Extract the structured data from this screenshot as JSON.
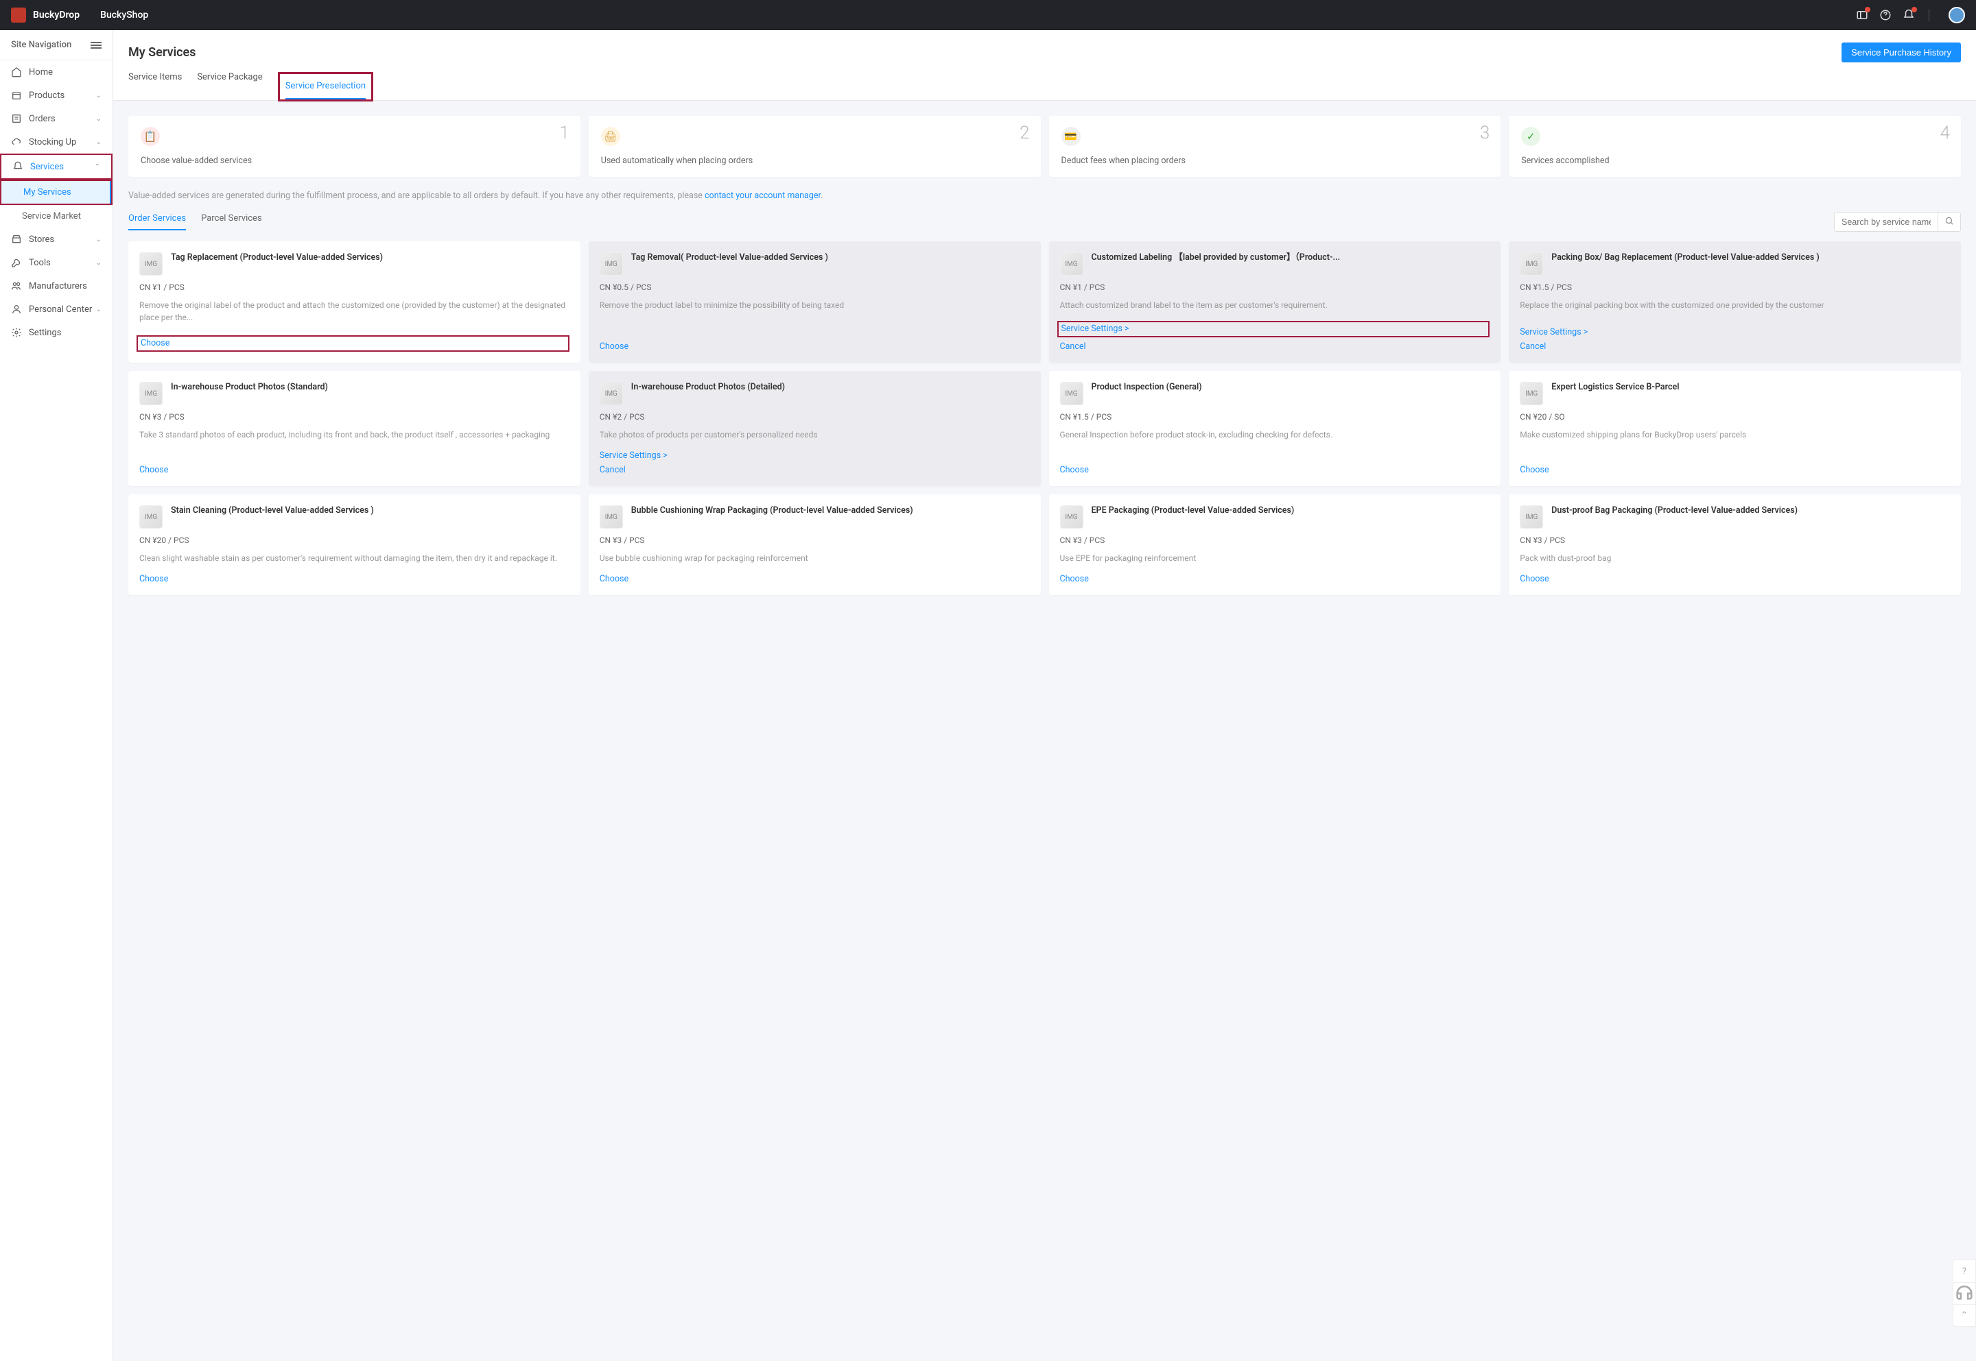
{
  "header": {
    "brand1": "BuckyDrop",
    "brand2": "BuckyShop"
  },
  "sidebar": {
    "navLabel": "Site Navigation",
    "items": [
      {
        "label": "Home",
        "icon": "home"
      },
      {
        "label": "Products",
        "icon": "box",
        "chev": true
      },
      {
        "label": "Orders",
        "icon": "list",
        "chev": true
      },
      {
        "label": "Stocking Up",
        "icon": "cloud",
        "chev": true
      },
      {
        "label": "Services",
        "icon": "bell",
        "chev": true,
        "open": true,
        "hl": true,
        "subs": [
          {
            "label": "My Services",
            "active": true,
            "hl": true
          },
          {
            "label": "Service Market"
          }
        ]
      },
      {
        "label": "Stores",
        "icon": "store",
        "chev": true
      },
      {
        "label": "Tools",
        "icon": "wrench",
        "chev": true
      },
      {
        "label": "Manufacturers",
        "icon": "people"
      },
      {
        "label": "Personal Center",
        "icon": "person",
        "chev": true
      },
      {
        "label": "Settings",
        "icon": "gear"
      }
    ]
  },
  "page": {
    "title": "My Services",
    "historyBtn": "Service Purchase History",
    "tabs": [
      "Service Items",
      "Service Package",
      "Service Preselection"
    ],
    "activeTab": 2
  },
  "steps": [
    {
      "n": "1",
      "label": "Choose value-added services"
    },
    {
      "n": "2",
      "label": "Used automatically when placing orders"
    },
    {
      "n": "3",
      "label": "Deduct fees when placing orders"
    },
    {
      "n": "4",
      "label": "Services accomplished"
    }
  ],
  "notice": {
    "text": "Value-added services are generated during the fulfillment process, and are applicable to all orders by default. If you have any other requirements, please ",
    "link": "contact your account manager"
  },
  "serviceTabs": [
    "Order Services",
    "Parcel Services"
  ],
  "search": {
    "placeholder": "Search by service name"
  },
  "actions": {
    "choose": "Choose",
    "settings": "Service Settings  >",
    "cancel": "Cancel"
  },
  "cards": [
    {
      "title": "Tag Replacement (Product-level Value-added Services)",
      "price": "CN ¥1 / PCS",
      "desc": "Remove the original label of the product and attach the customized one (provided by the customer) at the designated place per the...",
      "act": "choose",
      "hlAction": true
    },
    {
      "title": "Tag Removal( Product-level Value-added Services )",
      "price": "CN ¥0.5 / PCS",
      "desc": "Remove the product label to minimize the possibility of being taxed",
      "act": "choose",
      "sel": true
    },
    {
      "title": "Customized Labeling 【label provided by customer】（Product-...",
      "price": "CN ¥1 / PCS",
      "desc": "Attach customized brand label to the item as per customer's requirement.",
      "act": "settings",
      "hlAction": true,
      "sel": true
    },
    {
      "title": "Packing Box/ Bag Replacement (Product-level Value-added Services )",
      "price": "CN ¥1.5 / PCS",
      "desc": "Replace the original packing box with the customized one provided by the customer",
      "act": "settings",
      "sel": true
    },
    {
      "title": "In-warehouse Product Photos (Standard)",
      "price": "CN ¥3 / PCS",
      "desc": "Take 3 standard photos of each product, including its front and back, the product itself , accessories + packaging",
      "act": "choose"
    },
    {
      "title": "In-warehouse Product Photos (Detailed)",
      "price": "CN ¥2 / PCS",
      "desc": "Take photos of products per customer's personalized needs",
      "act": "settings",
      "sel": true
    },
    {
      "title": "Product Inspection (General)",
      "price": "CN ¥1.5 / PCS",
      "desc": "General Inspection before product stock-in, excluding checking for defects.",
      "act": "choose"
    },
    {
      "title": "Expert Logistics Service B-Parcel",
      "price": "CN ¥20 / SO",
      "desc": "Make customized shipping plans for BuckyDrop users' parcels",
      "act": "choose"
    },
    {
      "title": "Stain Cleaning (Product-level Value-added Services )",
      "price": "CN ¥20 / PCS",
      "desc": "Clean slight washable stain as per customer's requirement without damaging the item, then dry it and repackage it.",
      "act": "choose"
    },
    {
      "title": "Bubble Cushioning Wrap Packaging (Product-level Value-added Services)",
      "price": "CN ¥3 / PCS",
      "desc": "Use bubble cushioning wrap for packaging reinforcement",
      "act": "choose"
    },
    {
      "title": "EPE Packaging (Product-level Value-added Services)",
      "price": "CN ¥3 / PCS",
      "desc": "Use EPE for packaging reinforcement",
      "act": "choose"
    },
    {
      "title": "Dust-proof Bag Packaging (Product-level Value-added Services)",
      "price": "CN ¥3 / PCS",
      "desc": "Pack with dust-proof bag",
      "act": "choose"
    }
  ]
}
